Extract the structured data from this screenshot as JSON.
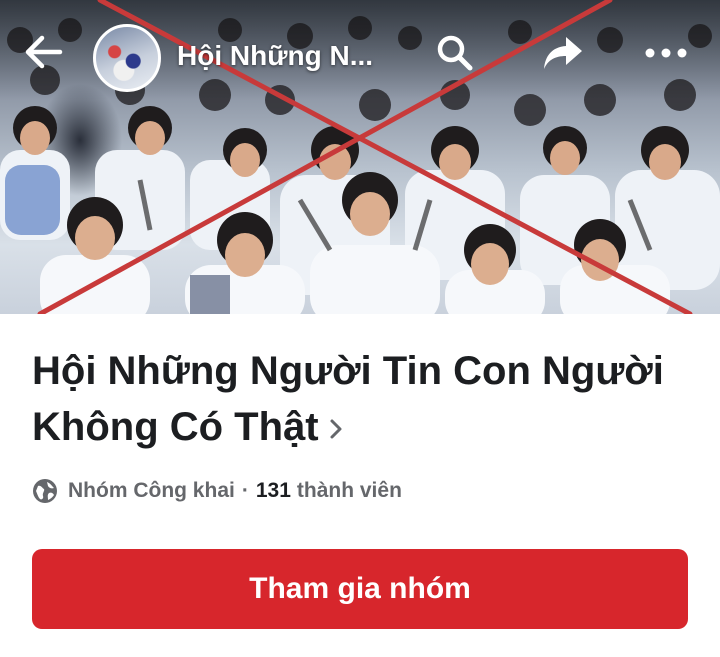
{
  "topbar": {
    "title": "Hội Những N..."
  },
  "group": {
    "name": "Hội Những Người Tin Con Người Không Có Thật",
    "privacy": "Nhóm Công khai",
    "separator": "·",
    "member_count": "131",
    "member_label": "thành viên"
  },
  "actions": {
    "join_label": "Tham gia nhóm"
  },
  "icons": {
    "back": "arrow-left-icon",
    "search": "search-icon",
    "share": "share-icon",
    "more": "more-horizontal-icon",
    "privacy": "globe-icon",
    "chevron": "chevron-right-icon"
  },
  "colors": {
    "join_button": "#d7262c",
    "cross_mark": "#c83a3a",
    "title_text": "#1c1e21",
    "meta_text": "#65676b"
  }
}
